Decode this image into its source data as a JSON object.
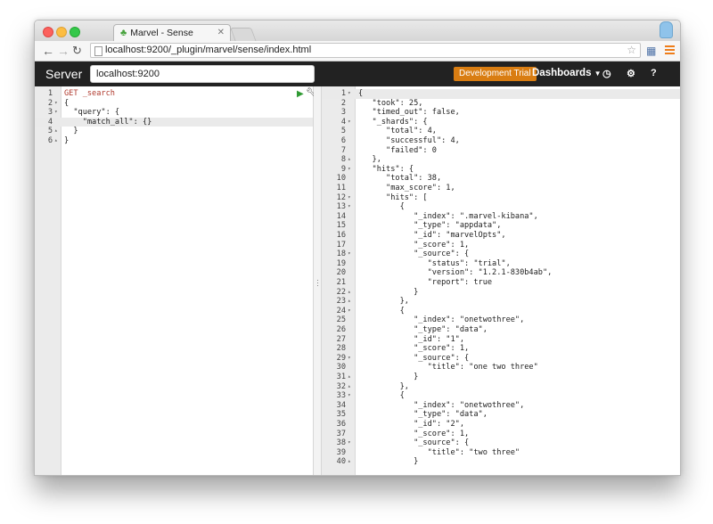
{
  "browser": {
    "tab_title": "Marvel - Sense",
    "tab_icon": "leaf-icon",
    "url": "localhost:9200/_plugin/marvel/sense/index.html"
  },
  "header": {
    "server_label": "Server",
    "server_value": "localhost:9200",
    "trial_button": "Development Trial",
    "dashboards": "Dashboards",
    "accent": "#d97d12",
    "bar_color": "#222222"
  },
  "request_editor": {
    "lines": [
      {
        "n": "1",
        "fold": "",
        "text": "GET _search"
      },
      {
        "n": "2",
        "fold": "▾",
        "text": "{"
      },
      {
        "n": "3",
        "fold": "▾",
        "text": "  \"query\": {"
      },
      {
        "n": "4",
        "fold": "",
        "text": "    \"match_all\": {}"
      },
      {
        "n": "5",
        "fold": "▴",
        "text": "  }"
      },
      {
        "n": "6",
        "fold": "▴",
        "text": "}"
      }
    ]
  },
  "response_viewer": {
    "lines": [
      {
        "n": "1",
        "fold": "▾",
        "text": "{"
      },
      {
        "n": "2",
        "fold": "",
        "text": "   \"took\": 25,"
      },
      {
        "n": "3",
        "fold": "",
        "text": "   \"timed_out\": false,"
      },
      {
        "n": "4",
        "fold": "▾",
        "text": "   \"_shards\": {"
      },
      {
        "n": "5",
        "fold": "",
        "text": "      \"total\": 4,"
      },
      {
        "n": "6",
        "fold": "",
        "text": "      \"successful\": 4,"
      },
      {
        "n": "7",
        "fold": "",
        "text": "      \"failed\": 0"
      },
      {
        "n": "8",
        "fold": "▴",
        "text": "   },"
      },
      {
        "n": "9",
        "fold": "▾",
        "text": "   \"hits\": {"
      },
      {
        "n": "10",
        "fold": "",
        "text": "      \"total\": 38,"
      },
      {
        "n": "11",
        "fold": "",
        "text": "      \"max_score\": 1,"
      },
      {
        "n": "12",
        "fold": "▾",
        "text": "      \"hits\": ["
      },
      {
        "n": "13",
        "fold": "▾",
        "text": "         {"
      },
      {
        "n": "14",
        "fold": "",
        "text": "            \"_index\": \".marvel-kibana\","
      },
      {
        "n": "15",
        "fold": "",
        "text": "            \"_type\": \"appdata\","
      },
      {
        "n": "16",
        "fold": "",
        "text": "            \"_id\": \"marvelOpts\","
      },
      {
        "n": "17",
        "fold": "",
        "text": "            \"_score\": 1,"
      },
      {
        "n": "18",
        "fold": "▾",
        "text": "            \"_source\": {"
      },
      {
        "n": "19",
        "fold": "",
        "text": "               \"status\": \"trial\","
      },
      {
        "n": "20",
        "fold": "",
        "text": "               \"version\": \"1.2.1-830b4ab\","
      },
      {
        "n": "21",
        "fold": "",
        "text": "               \"report\": true"
      },
      {
        "n": "22",
        "fold": "▴",
        "text": "            }"
      },
      {
        "n": "23",
        "fold": "▴",
        "text": "         },"
      },
      {
        "n": "24",
        "fold": "▾",
        "text": "         {"
      },
      {
        "n": "25",
        "fold": "",
        "text": "            \"_index\": \"onetwothree\","
      },
      {
        "n": "26",
        "fold": "",
        "text": "            \"_type\": \"data\","
      },
      {
        "n": "27",
        "fold": "",
        "text": "            \"_id\": \"1\","
      },
      {
        "n": "28",
        "fold": "",
        "text": "            \"_score\": 1,"
      },
      {
        "n": "29",
        "fold": "▾",
        "text": "            \"_source\": {"
      },
      {
        "n": "30",
        "fold": "",
        "text": "               \"title\": \"one two three\""
      },
      {
        "n": "31",
        "fold": "▴",
        "text": "            }"
      },
      {
        "n": "32",
        "fold": "▴",
        "text": "         },"
      },
      {
        "n": "33",
        "fold": "▾",
        "text": "         {"
      },
      {
        "n": "34",
        "fold": "",
        "text": "            \"_index\": \"onetwothree\","
      },
      {
        "n": "35",
        "fold": "",
        "text": "            \"_type\": \"data\","
      },
      {
        "n": "36",
        "fold": "",
        "text": "            \"_id\": \"2\","
      },
      {
        "n": "37",
        "fold": "",
        "text": "            \"_score\": 1,"
      },
      {
        "n": "38",
        "fold": "▾",
        "text": "            \"_source\": {"
      },
      {
        "n": "39",
        "fold": "",
        "text": "               \"title\": \"two three\""
      },
      {
        "n": "40",
        "fold": "▴",
        "text": "            }"
      }
    ]
  }
}
